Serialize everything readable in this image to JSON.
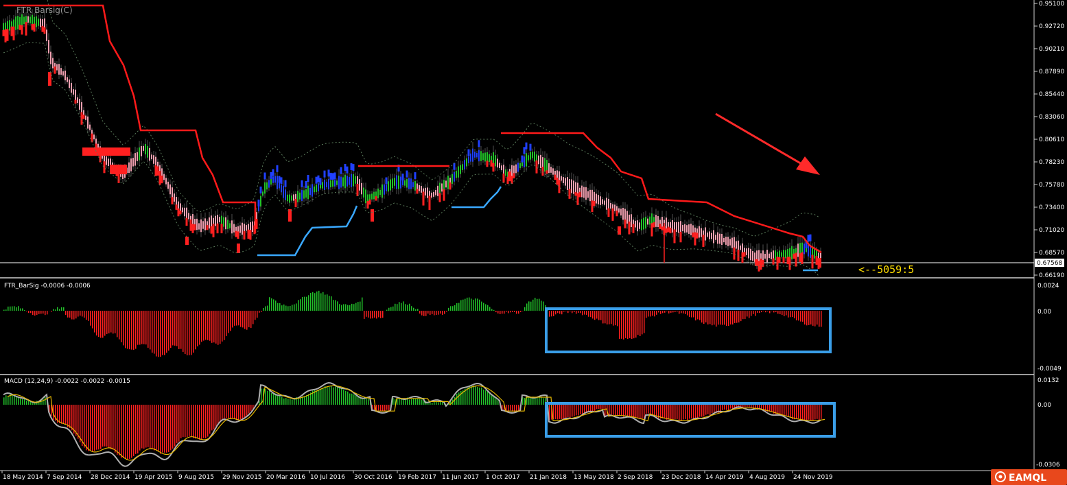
{
  "main_panel": {
    "title": "FTR Barsig(C)",
    "price_labels": [
      "0.95100",
      "0.92720",
      "0.90210",
      "0.87890",
      "0.85440",
      "0.83060",
      "0.80610",
      "0.78230",
      "0.75780",
      "0.73400",
      "0.71020",
      "0.68570",
      "0.66190"
    ],
    "current_price": "0.67568",
    "signal_text": "<--5059:5"
  },
  "ftr_panel": {
    "title": "FTR_BarSig -0.0006 -0.0006",
    "labels": [
      "0.0024",
      "0.00",
      "-0.0049"
    ]
  },
  "macd_panel": {
    "title": "MACD (12,24,9) -0.0022 -0.0022 -0.0015",
    "labels": [
      "0.0132",
      "0.00",
      "-0.0306"
    ]
  },
  "time_labels": [
    "18 May 2014",
    "7 Sep 2014",
    "28 Dec 2014",
    "19 Apr 2015",
    "9 Aug 2015",
    "29 Nov 2015",
    "20 Mar 2016",
    "10 Jul 2016",
    "30 Oct 2016",
    "19 Feb 2017",
    "11 Jun 2017",
    "1 Oct 2017",
    "21 Jan 2018",
    "13 May 2018",
    "2 Sep 2018",
    "23 Dec 2018",
    "14 Apr 2019",
    "4 Aug 2019",
    "24 Nov 2019"
  ],
  "logo": {
    "text": "EAMQL"
  },
  "colors": {
    "background": "#000000",
    "stop_line": "#ff1a1a",
    "support_line": "#3aa8ff",
    "bar_up": "#22c22a",
    "bar_down": "#ff2020",
    "bar_neutral": "#f0a0b0",
    "bar_strong": "#2040ff",
    "macd_signal": "#e6b800",
    "macd_line": "#b0b0b0",
    "highlight_box": "#3a9ee8",
    "arrow": "#ff2a2a",
    "signal_text": "#ffdd00"
  },
  "chart_data": {
    "type": "line",
    "x": [
      "18 May 2014",
      "7 Sep 2014",
      "28 Dec 2014",
      "19 Apr 2015",
      "9 Aug 2015",
      "29 Nov 2015",
      "20 Mar 2016",
      "10 Jul 2016",
      "30 Oct 2016",
      "19 Feb 2017",
      "11 Jun 2017",
      "1 Oct 2017",
      "21 Jan 2018",
      "13 May 2018",
      "2 Sep 2018",
      "23 Dec 2018",
      "14 Apr 2019",
      "4 Aug 2019",
      "24 Nov 2019"
    ],
    "series": [
      {
        "values": [
          0.94,
          0.905,
          0.8,
          0.79,
          0.715,
          0.705,
          0.745,
          0.76,
          0.755,
          0.758,
          0.775,
          0.77,
          0.78,
          0.76,
          0.725,
          0.705,
          0.69,
          0.68,
          0.676
        ]
      }
    ],
    "ylim": [
      0.6619,
      0.951
    ]
  }
}
